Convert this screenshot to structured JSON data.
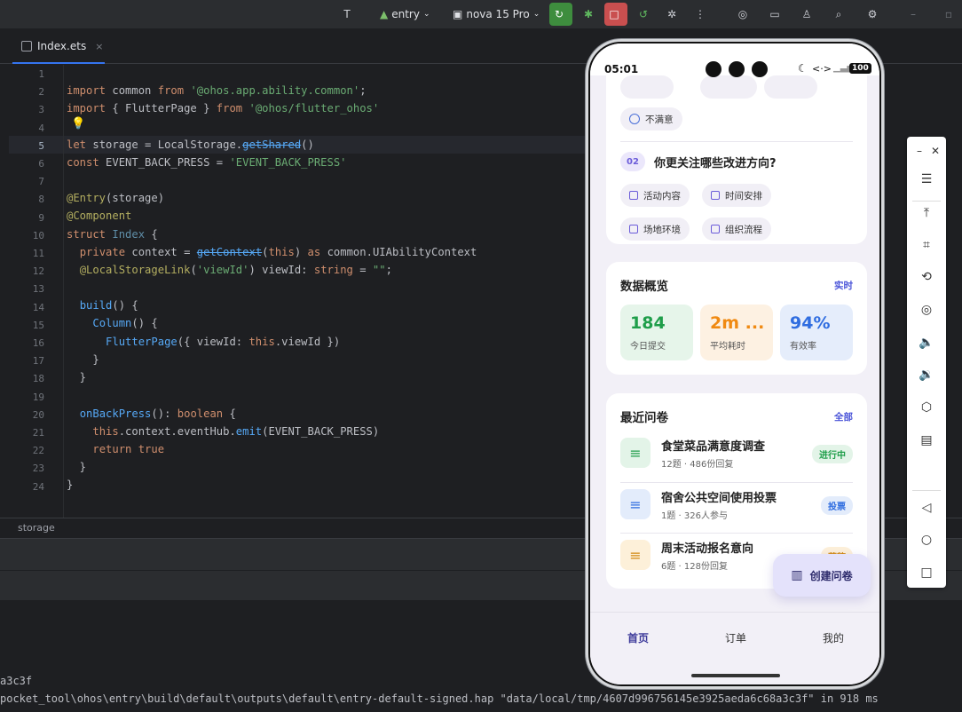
{
  "toolbar": {
    "module": "entry",
    "device": "nova 15 Pro"
  },
  "editor": {
    "tab_label": "Index.ets",
    "tab_close": "×",
    "line_numbers": [
      "1",
      "2",
      "3",
      "4",
      "5",
      "6",
      "7",
      "8",
      "9",
      "10",
      "11",
      "12",
      "13",
      "14",
      "15",
      "16",
      "17",
      "18",
      "19",
      "20",
      "21",
      "22",
      "23",
      "24"
    ],
    "breadcrumb": "storage"
  },
  "console": {
    "line1": "a3c3f",
    "line2": "pocket_tool\\ohos\\entry\\build\\default\\outputs\\default\\entry-default-signed.hap \"data/local/tmp/4607d996756145e3925aeda6c68a3c3f\" in 918 ms"
  },
  "phone": {
    "time": "05:01",
    "battery": "100",
    "signal_glyphs": "<·>",
    "q1_option_last": "不满意",
    "q2_number": "02",
    "q2_title": "你更关注哪些改进方向?",
    "q2_options": [
      "活动内容",
      "时间安排",
      "场地环境",
      "组织流程"
    ],
    "overview": {
      "title": "数据概览",
      "link": "实时",
      "stats": [
        {
          "value": "184",
          "label": "今日提交",
          "color": "#1f9e4a",
          "bg": "#e6f5ea"
        },
        {
          "value": "2m ...",
          "label": "平均耗时",
          "color": "#f08a12",
          "bg": "#fdf1e2"
        },
        {
          "value": "94%",
          "label": "有效率",
          "color": "#2f6de0",
          "bg": "#e5edfb"
        }
      ]
    },
    "recent": {
      "title": "最近问卷",
      "link": "全部",
      "items": [
        {
          "title": "食堂菜品满意度调查",
          "meta": "12题 · 486份回复",
          "badge": "进行中",
          "badge_color": "#1f9e4a",
          "badge_bg": "#e3f4e8",
          "icon_bg": "#e3f4e8",
          "icon_color": "#1f9e4a"
        },
        {
          "title": "宿舍公共空间使用投票",
          "meta": "1题 · 326人参与",
          "badge": "投票",
          "badge_color": "#2f6de0",
          "badge_bg": "#e3ecfb",
          "icon_bg": "#e3ecfb",
          "icon_color": "#2f6de0"
        },
        {
          "title": "周末活动报名意向",
          "meta": "6题 · 128份回复",
          "badge": "草稿",
          "badge_color": "#d38a12",
          "badge_bg": "#fdf0d9",
          "icon_bg": "#fdf0d9",
          "icon_color": "#d38a12"
        }
      ]
    },
    "fab_label": "创建问卷",
    "nav": [
      "首页",
      "订单",
      "我的"
    ]
  }
}
